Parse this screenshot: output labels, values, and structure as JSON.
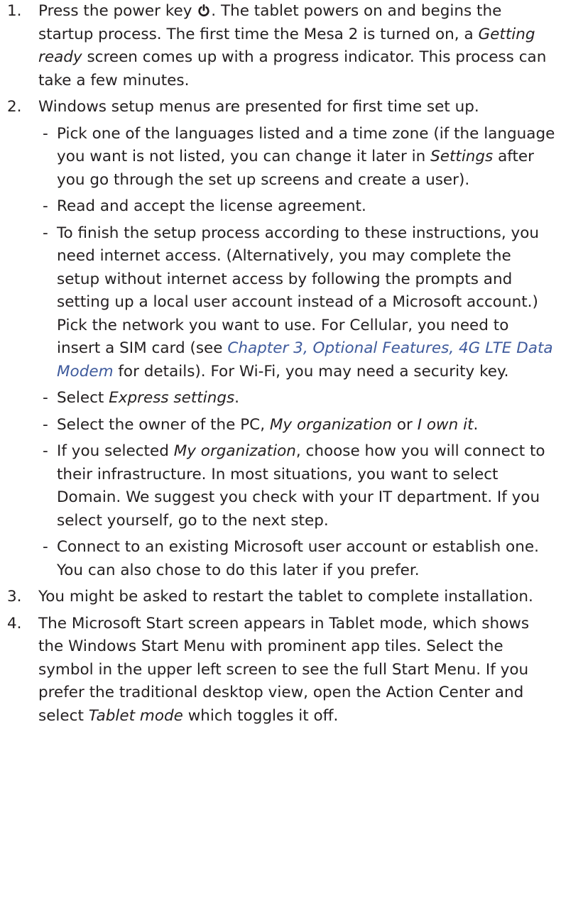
{
  "steps": [
    {
      "num": "1.",
      "parts": [
        "Press the power key ",
        ". The tablet powers on and begins the startup process. The first time the Mesa 2 is turned on, a ",
        "Getting ready",
        " screen comes up with a progress indicator. This process can take a few minutes."
      ]
    },
    {
      "num": "2.",
      "text": "Windows setup menus are presented for first time set up.",
      "sub": [
        {
          "parts": [
            "Pick one of the languages listed and a time zone (if the language you want is not listed, you can change it later in ",
            "Settings",
            " after you go through the set up screens and create a user)."
          ]
        },
        {
          "parts": [
            "Read and accept the license agreement."
          ]
        },
        {
          "parts": [
            "To finish the setup process according to these instructions, you need internet access. (Alternatively, you may complete the setup without internet access by following the prompts and setting up a local user account instead of a Microsoft account.) Pick the network you want to use. For Cellular, you need to insert a SIM card (see ",
            "Chapter 3, Optional Features, 4G LTE Data Modem",
            " for details). For Wi-Fi, you may need a security key."
          ]
        },
        {
          "parts": [
            "Select ",
            "Express settings",
            "."
          ]
        },
        {
          "parts": [
            "Select the owner of the PC, ",
            "My organization",
            " or ",
            "I own it",
            "."
          ]
        },
        {
          "parts": [
            "If you selected ",
            "My organization",
            ", choose how you will connect to their infrastructure. In most situations, you want to select Domain. We suggest you check with your IT department. If you select yourself, go to the next step."
          ]
        },
        {
          "parts": [
            "Connect to an existing Microsoft user account or establish one. You can also chose to do this later if you prefer."
          ]
        }
      ]
    },
    {
      "num": "3.",
      "text": "You might be asked to restart the tablet to complete installation."
    },
    {
      "num": "4.",
      "parts": [
        "The Microsoft Start screen appears in Tablet mode, which shows the Windows Start Menu with prominent app tiles. Select the symbol in the upper left screen to see the full Start Menu. If you prefer the traditional desktop view, open the Action Center and select ",
        "Tablet mode",
        " which toggles it off."
      ]
    }
  ],
  "dash": "-",
  "icons": {
    "power": "power-icon"
  },
  "colors": {
    "text": "#231f20",
    "link": "#3e5a9c"
  }
}
